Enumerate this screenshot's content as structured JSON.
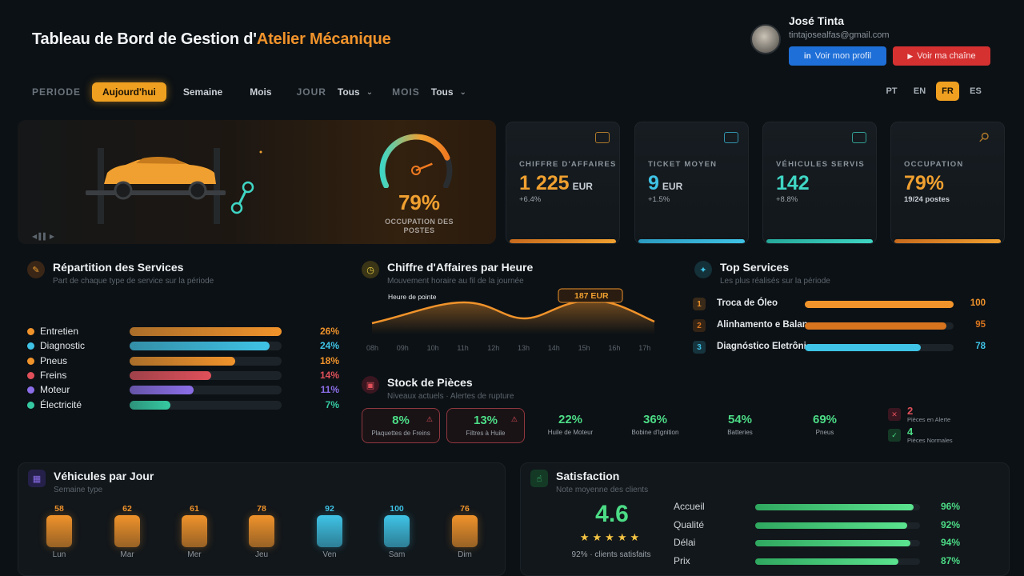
{
  "header": {
    "title_main": "Tableau de Bord de Gestion d'",
    "title_accent": "Atelier Mécanique",
    "user_name": "José Tinta",
    "user_email": "tintajosealfas@gmail.com",
    "linkedin_label": "Voir mon profil",
    "youtube_label": "Voir ma chaîne"
  },
  "filters": {
    "period_label": "PERIODE",
    "periods": [
      "Aujourd'hui",
      "Semaine",
      "Mois"
    ],
    "active_period": "Aujourd'hui",
    "day_label": "JOUR",
    "day_value": "Tous",
    "month_label": "MOIS",
    "month_value": "Tous"
  },
  "languages": [
    "PT",
    "EN",
    "FR",
    "ES"
  ],
  "active_language": "FR",
  "hero": {
    "occupancy_value": "79%",
    "occupancy_fraction": 0.79,
    "occupancy_caption_1": "OCCUPATION DES",
    "occupancy_caption_2": "POSTES"
  },
  "kpis": [
    {
      "label": "CHIFFRE D'AFFAIRES",
      "value": "1 225",
      "unit": "EUR",
      "sub": "+6.4%",
      "color": "#f0a030",
      "icon": "cash-icon"
    },
    {
      "label": "TICKET MOYEN",
      "value": "9",
      "unit": "EUR",
      "sub": "+1.5%",
      "color": "#3fc3e6",
      "icon": "receipt-icon"
    },
    {
      "label": "VÉHICULES SERVIS",
      "value": "142",
      "unit": "",
      "sub": "+8.8%",
      "color": "#3fd6c4",
      "icon": "car-icon"
    },
    {
      "label": "OCCUPATION",
      "value": "79%",
      "unit": "",
      "sub": "19/24 postes",
      "color": "#f0a030",
      "icon": "wrench-icon"
    }
  ],
  "services": {
    "title": "Répartition des Services",
    "subtitle": "Part de chaque type de service sur la période",
    "items": [
      {
        "name": "Entretien",
        "pct": "26%",
        "value": 26,
        "color": "#f0932b"
      },
      {
        "name": "Diagnostic",
        "pct": "24%",
        "value": 24,
        "color": "#3fc3e6"
      },
      {
        "name": "Pneus",
        "pct": "18%",
        "value": 18,
        "color": "#f0932b"
      },
      {
        "name": "Freins",
        "pct": "14%",
        "value": 14,
        "color": "#e0505a"
      },
      {
        "name": "Moteur",
        "pct": "11%",
        "value": 11,
        "color": "#8b6ee8"
      },
      {
        "name": "Électricité",
        "pct": "7%",
        "value": 7,
        "color": "#35c9a2"
      }
    ]
  },
  "revenue": {
    "title": "Chiffre d'Affaires par Heure",
    "subtitle": "Mouvement horaire au fil de la journée",
    "peak_label": "Heure de pointe",
    "callout": "187 EUR",
    "hours": [
      "08h",
      "09h",
      "10h",
      "11h",
      "12h",
      "13h",
      "14h",
      "15h",
      "16h",
      "17h"
    ]
  },
  "top_services": {
    "title": "Top Services",
    "subtitle": "Les plus réalisés sur la période",
    "items": [
      {
        "rank": "1",
        "name": "Troca de Óleo",
        "value": "100",
        "num": 100,
        "color": "#f0932b"
      },
      {
        "rank": "2",
        "name": "Alinhamento e Balan",
        "value": "95",
        "num": 95,
        "color": "#d8741e"
      },
      {
        "rank": "3",
        "name": "Diagnóstico Eletrôni",
        "value": "78",
        "num": 78,
        "color": "#3fc3e6"
      }
    ]
  },
  "stock": {
    "title": "Stock de Pièces",
    "subtitle": "Niveaux actuels · Alertes de rupture",
    "items": [
      {
        "value": "8%",
        "label": "Plaquettes de Freins",
        "color": "#e0505a",
        "alert": true
      },
      {
        "value": "13%",
        "label": "Filtres à Huile",
        "color": "#e0505a",
        "alert": true
      },
      {
        "value": "22%",
        "label": "Huile de Moteur",
        "color": "#4cdc86",
        "alert": false
      },
      {
        "value": "36%",
        "label": "Bobine d'Ignition",
        "color": "#4cdc86",
        "alert": false
      },
      {
        "value": "54%",
        "label": "Batteries",
        "color": "#4cdc86",
        "alert": false
      },
      {
        "value": "69%",
        "label": "Pneus",
        "color": "#4cdc86",
        "alert": false
      }
    ],
    "alerts": [
      {
        "count": "2",
        "text": "Pièces en Alerte",
        "color": "#e0505a"
      },
      {
        "count": "4",
        "text": "Pièces Normales",
        "color": "#4cdc86"
      }
    ]
  },
  "vehicles": {
    "title": "Véhicules par Jour",
    "subtitle": "Semaine type",
    "days": [
      {
        "day": "Lun",
        "value": "58",
        "num": 58,
        "color": "#f0932b"
      },
      {
        "day": "Mar",
        "value": "62",
        "num": 62,
        "color": "#f0932b"
      },
      {
        "day": "Mer",
        "value": "61",
        "num": 61,
        "color": "#f0932b"
      },
      {
        "day": "Jeu",
        "value": "78",
        "num": 78,
        "color": "#f0932b"
      },
      {
        "day": "Ven",
        "value": "92",
        "num": 92,
        "color": "#3fc3e6"
      },
      {
        "day": "Sam",
        "value": "100",
        "num": 100,
        "color": "#3fc3e6"
      },
      {
        "day": "Dim",
        "value": "76",
        "num": 76,
        "color": "#f0932b"
      }
    ]
  },
  "satisfaction": {
    "title": "Satisfaction",
    "subtitle": "Note moyenne des clients",
    "score": "4.6",
    "stars": "★★★★★",
    "caption": "92% · clients satisfaits",
    "items": [
      {
        "name": "Accueil",
        "pct": "96%",
        "value": 96
      },
      {
        "name": "Qualité",
        "pct": "92%",
        "value": 92
      },
      {
        "name": "Délai",
        "pct": "94%",
        "value": 94
      },
      {
        "name": "Prix",
        "pct": "87%",
        "value": 87
      }
    ]
  }
}
